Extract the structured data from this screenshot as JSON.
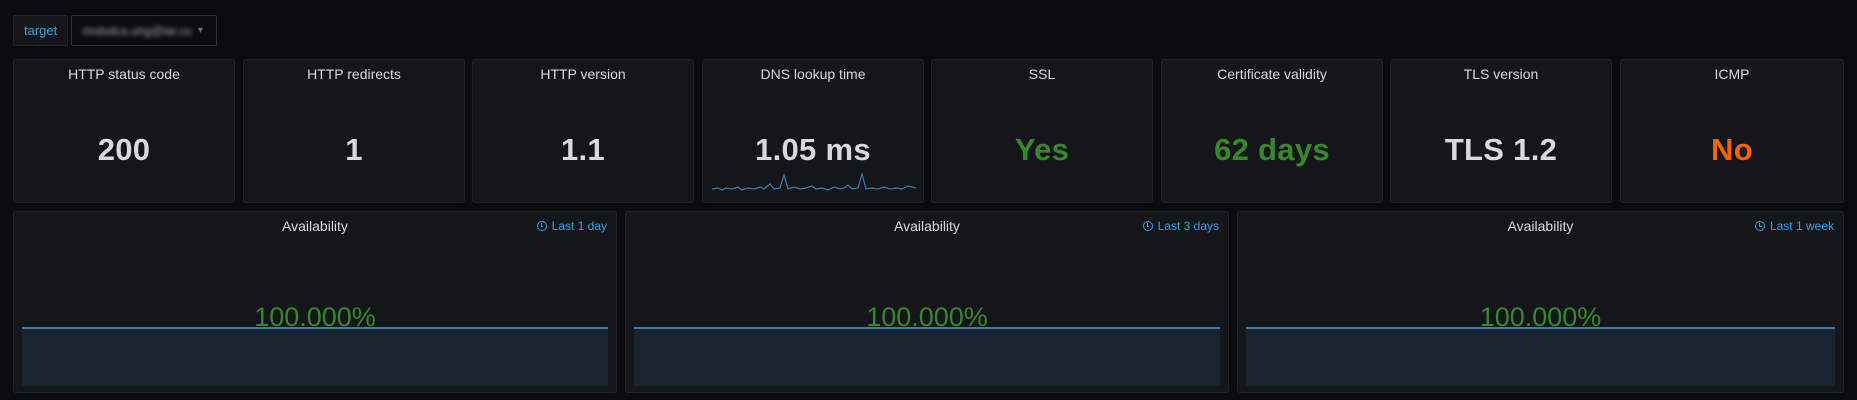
{
  "variables": {
    "target_label": "target",
    "target_value": "rindsdca.uhg@tai.cu"
  },
  "stats": [
    {
      "title": "HTTP status code",
      "value": "200",
      "color": "#d8d9da"
    },
    {
      "title": "HTTP redirects",
      "value": "1",
      "color": "#d8d9da"
    },
    {
      "title": "HTTP version",
      "value": "1.1",
      "color": "#d8d9da"
    },
    {
      "title": "DNS lookup time",
      "value": "1.05 ms",
      "color": "#d8d9da",
      "sparkline_color": "#3b7bb2"
    },
    {
      "title": "SSL",
      "value": "Yes",
      "color": "#37872d"
    },
    {
      "title": "Certificate validity",
      "value": "62 days",
      "color": "#37872d"
    },
    {
      "title": "TLS version",
      "value": "TLS 1.2",
      "color": "#d8d9da"
    },
    {
      "title": "ICMP",
      "value": "No",
      "color": "#fa6400"
    }
  ],
  "availability": [
    {
      "title": "Availability",
      "range": "Last 1 day",
      "value": "100.000%"
    },
    {
      "title": "Availability",
      "range": "Last 3 days",
      "value": "100.000%"
    },
    {
      "title": "Availability",
      "range": "Last 1 week",
      "value": "100.000%"
    }
  ],
  "colors": {
    "background": "#0b0c0e",
    "panel": "#141619",
    "accent_blue": "#33a2e5",
    "ok_green": "#37872d",
    "warn_orange": "#fa6400"
  }
}
